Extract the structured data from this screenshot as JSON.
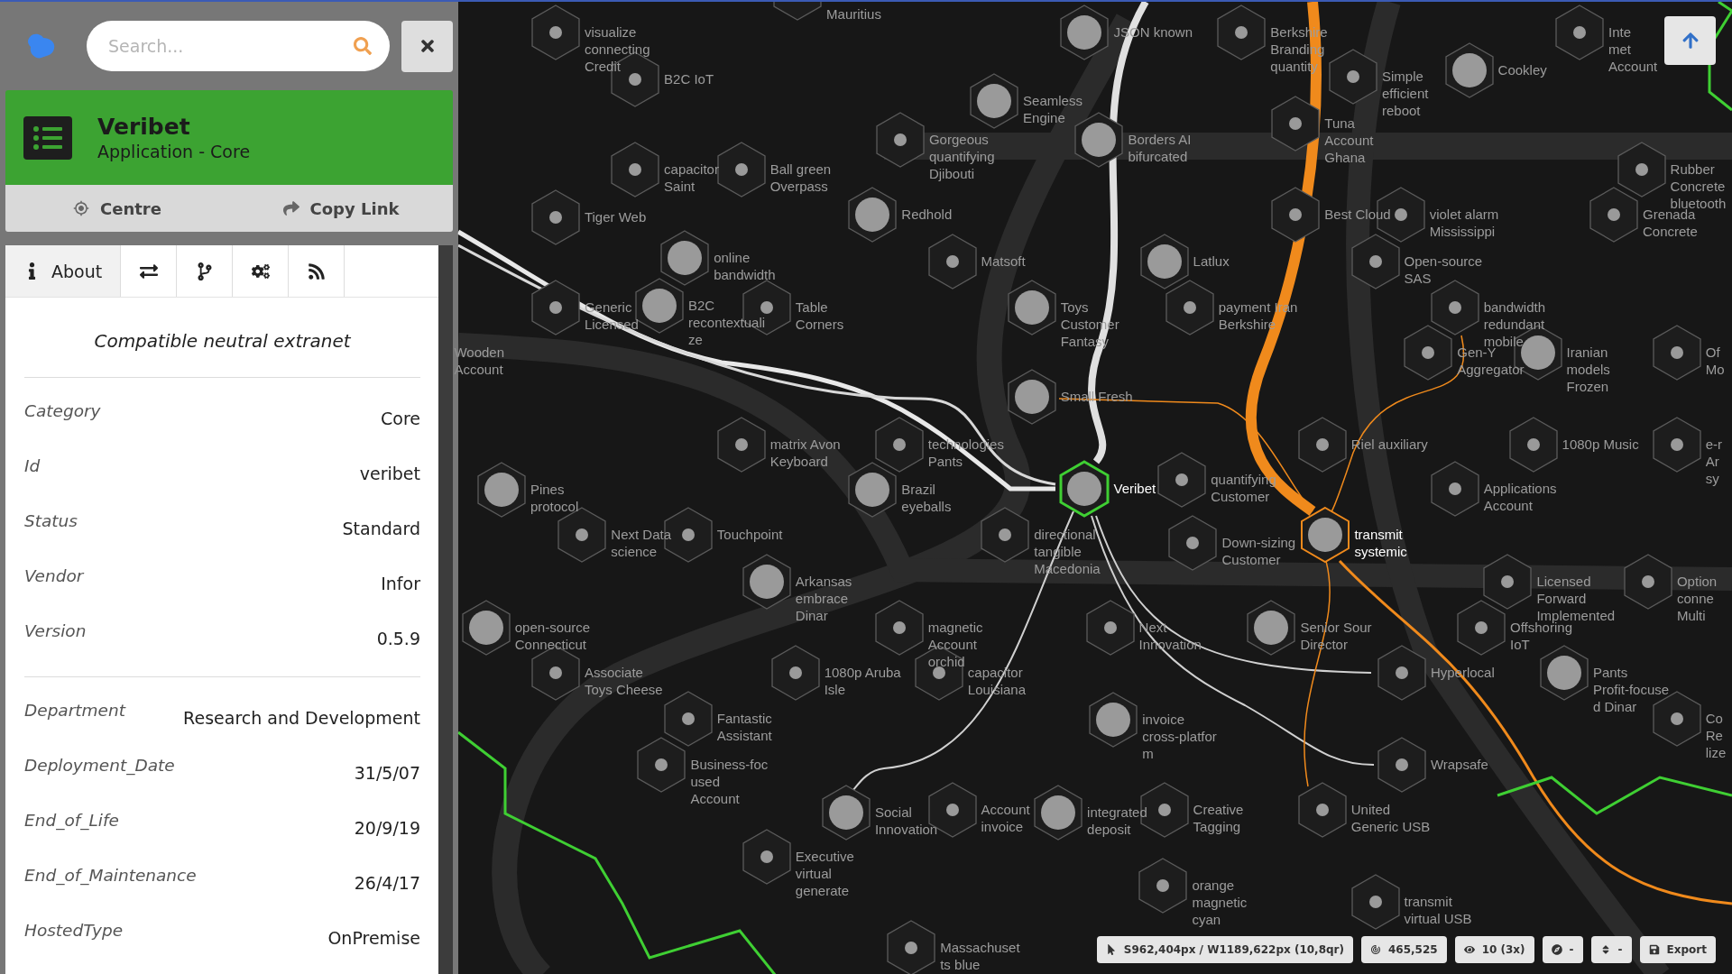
{
  "search": {
    "placeholder": "Search..."
  },
  "entity": {
    "title": "Veribet",
    "subtitle": "Application - Core"
  },
  "actions": [
    {
      "label": "Centre"
    },
    {
      "label": "Copy Link"
    }
  ],
  "tabs": [
    {
      "label": "About",
      "selected": true
    },
    {
      "selected": false
    },
    {
      "selected": false
    },
    {
      "selected": false
    },
    {
      "selected": false
    }
  ],
  "about": {
    "description": "Compatible neutral extranet",
    "property_groups": [
      [
        {
          "name": "Category",
          "value": "Core"
        },
        {
          "name": "Id",
          "value": "veribet"
        },
        {
          "name": "Status",
          "value": "Standard"
        },
        {
          "name": "Vendor",
          "value": "Infor"
        },
        {
          "name": "Version",
          "value": "0.5.9"
        }
      ],
      [
        {
          "name": "Department",
          "value": "Research and Development"
        },
        {
          "name": "Deployment_Date",
          "value": "31/5/07"
        },
        {
          "name": "End_of_Life",
          "value": "20/9/19"
        },
        {
          "name": "End_of_Maintenance",
          "value": "26/4/17"
        },
        {
          "name": "HostedType",
          "value": "OnPremise"
        }
      ]
    ]
  },
  "map_nodes": [
    {
      "lines": [
        "visualize",
        "connecting",
        "Credit"
      ],
      "big": false,
      "kind": "plain"
    },
    {
      "lines": [
        "B2C IoT"
      ],
      "big": false,
      "kind": "plain"
    },
    {
      "lines": [
        "Mauritius"
      ],
      "big": false,
      "kind": "plain"
    },
    {
      "lines": [
        "JSON known"
      ],
      "big": true,
      "kind": "plain"
    },
    {
      "lines": [
        "Berkshire",
        "Branding",
        "quantity"
      ],
      "big": false,
      "kind": "plain"
    },
    {
      "lines": [
        "Simple",
        "efficient",
        "reboot"
      ],
      "big": false,
      "kind": "plain"
    },
    {
      "lines": [
        "Cookley"
      ],
      "big": true,
      "kind": "plain"
    },
    {
      "lines": [
        "Inte",
        "met",
        "Account"
      ],
      "big": false,
      "kind": "plain"
    },
    {
      "lines": [
        "Gorgeous",
        "quantifying",
        "Djibouti"
      ],
      "big": false,
      "kind": "plain"
    },
    {
      "lines": [
        "Seamless",
        "Engine"
      ],
      "big": true,
      "kind": "plain"
    },
    {
      "lines": [
        "Borders AI",
        "bifurcated"
      ],
      "big": true,
      "kind": "plain"
    },
    {
      "lines": [
        "Tuna",
        "Account",
        "Ghana"
      ],
      "big": false,
      "kind": "plain"
    },
    {
      "lines": [
        "capacitor",
        "Saint"
      ],
      "big": false,
      "kind": "plain"
    },
    {
      "lines": [
        "Ball green",
        "Overpass"
      ],
      "big": false,
      "kind": "plain"
    },
    {
      "lines": [
        "Rubber",
        "Concrete",
        "bluetooth"
      ],
      "big": false,
      "kind": "plain"
    },
    {
      "lines": [
        "Tiger Web"
      ],
      "big": false,
      "kind": "plain"
    },
    {
      "lines": [
        "Redhold"
      ],
      "big": true,
      "kind": "plain"
    },
    {
      "lines": [
        "Best Cloud"
      ],
      "big": false,
      "kind": "plain"
    },
    {
      "lines": [
        "violet alarm",
        "Mississippi"
      ],
      "big": false,
      "kind": "plain"
    },
    {
      "lines": [
        "Grenada",
        "Concrete"
      ],
      "big": false,
      "kind": "plain"
    },
    {
      "lines": [
        "online",
        "bandwidth"
      ],
      "big": true,
      "kind": "plain"
    },
    {
      "lines": [
        "Matsoft"
      ],
      "big": false,
      "kind": "plain"
    },
    {
      "lines": [
        "Latlux"
      ],
      "big": true,
      "kind": "plain"
    },
    {
      "lines": [
        "Open-source",
        "SAS"
      ],
      "big": false,
      "kind": "plain"
    },
    {
      "lines": [
        "Generic",
        "Licensed"
      ],
      "big": false,
      "kind": "plain"
    },
    {
      "lines": [
        "B2C",
        "recontextuali",
        "ze"
      ],
      "big": true,
      "kind": "plain"
    },
    {
      "lines": [
        "Table",
        "Corners"
      ],
      "big": false,
      "kind": "plain"
    },
    {
      "lines": [
        "Toys",
        "Customer",
        "Fantasy"
      ],
      "big": true,
      "kind": "plain"
    },
    {
      "lines": [
        "payment Iran",
        "Berkshire"
      ],
      "big": false,
      "kind": "plain"
    },
    {
      "lines": [
        "bandwidth",
        "redundant",
        "mobile"
      ],
      "big": false,
      "kind": "plain"
    },
    {
      "lines": [
        "Gen-Y",
        "Aggregator"
      ],
      "big": false,
      "kind": "plain"
    },
    {
      "lines": [
        "Iranian",
        "models",
        "Frozen"
      ],
      "big": true,
      "kind": "plain"
    },
    {
      "lines": [
        "Of",
        "Mo"
      ],
      "big": false,
      "kind": "plain"
    },
    {
      "lines": [
        "Small Fresh"
      ],
      "big": true,
      "kind": "plain"
    },
    {
      "lines": [
        "matrix Avon",
        "Keyboard"
      ],
      "big": false,
      "kind": "plain"
    },
    {
      "lines": [
        "technologies",
        "Pants"
      ],
      "big": false,
      "kind": "plain"
    },
    {
      "lines": [
        "Riel auxiliary"
      ],
      "big": false,
      "kind": "plain"
    },
    {
      "lines": [
        "1080p Music"
      ],
      "big": false,
      "kind": "plain"
    },
    {
      "lines": [
        "e-r",
        "Ar",
        "sy"
      ],
      "big": false,
      "kind": "plain"
    },
    {
      "lines": [
        "Pines",
        "protocol"
      ],
      "big": true,
      "kind": "plain"
    },
    {
      "lines": [
        "Brazil",
        "eyeballs"
      ],
      "big": true,
      "kind": "plain"
    },
    {
      "lines": [
        "Veribet"
      ],
      "big": true,
      "kind": "selected"
    },
    {
      "lines": [
        "quantifying",
        "Customer"
      ],
      "big": false,
      "kind": "plain"
    },
    {
      "lines": [
        "Applications",
        "Account"
      ],
      "big": false,
      "kind": "plain"
    },
    {
      "lines": [
        "Next Data",
        "science"
      ],
      "big": false,
      "kind": "plain"
    },
    {
      "lines": [
        "Touchpoint"
      ],
      "big": false,
      "kind": "plain"
    },
    {
      "lines": [
        "directional",
        "tangible",
        "Macedonia"
      ],
      "big": false,
      "kind": "plain"
    },
    {
      "lines": [
        "Down-sizing",
        "Customer"
      ],
      "big": false,
      "kind": "plain"
    },
    {
      "lines": [
        "transmit",
        "systemic"
      ],
      "big": true,
      "kind": "hovered"
    },
    {
      "lines": [
        "Arkansas",
        "embrace",
        "Dinar"
      ],
      "big": true,
      "kind": "plain"
    },
    {
      "lines": [
        "Licensed",
        "Forward",
        "Implemented"
      ],
      "big": false,
      "kind": "plain"
    },
    {
      "lines": [
        "Option",
        "conne",
        "Multi"
      ],
      "big": false,
      "kind": "plain"
    },
    {
      "lines": [
        "open-source",
        "Connecticut"
      ],
      "big": true,
      "kind": "plain"
    },
    {
      "lines": [
        "magnetic",
        "Account",
        "orchid"
      ],
      "big": false,
      "kind": "plain"
    },
    {
      "lines": [
        "Next",
        "Innovation"
      ],
      "big": false,
      "kind": "plain"
    },
    {
      "lines": [
        "Senior Sour",
        "Director"
      ],
      "big": true,
      "kind": "plain"
    },
    {
      "lines": [
        "Offshoring",
        "IoT"
      ],
      "big": false,
      "kind": "plain"
    },
    {
      "lines": [
        "Associate",
        "Toys Cheese"
      ],
      "big": false,
      "kind": "plain"
    },
    {
      "lines": [
        "1080p Aruba",
        "Isle"
      ],
      "big": false,
      "kind": "plain"
    },
    {
      "lines": [
        "capacitor",
        "Louisiana"
      ],
      "big": false,
      "kind": "plain"
    },
    {
      "lines": [
        "Hyperlocal"
      ],
      "big": false,
      "kind": "plain"
    },
    {
      "lines": [
        "Pants",
        "Profit-focuse",
        "d Dinar"
      ],
      "big": true,
      "kind": "plain"
    },
    {
      "lines": [
        "Fantastic",
        "Assistant"
      ],
      "big": false,
      "kind": "plain"
    },
    {
      "lines": [
        "invoice",
        "cross-platfor",
        "m"
      ],
      "big": true,
      "kind": "plain"
    },
    {
      "lines": [
        "Co",
        "Re",
        "lize"
      ],
      "big": false,
      "kind": "plain"
    },
    {
      "lines": [
        "Business-foc",
        "used",
        "Account"
      ],
      "big": false,
      "kind": "plain"
    },
    {
      "lines": [
        "Wrapsafe"
      ],
      "big": false,
      "kind": "plain"
    },
    {
      "lines": [
        "Social",
        "Innovation"
      ],
      "big": true,
      "kind": "plain"
    },
    {
      "lines": [
        "Account",
        "invoice"
      ],
      "big": false,
      "kind": "plain"
    },
    {
      "lines": [
        "integrated",
        "deposit"
      ],
      "big": true,
      "kind": "plain"
    },
    {
      "lines": [
        "Creative",
        "Tagging"
      ],
      "big": false,
      "kind": "plain"
    },
    {
      "lines": [
        "United",
        "Generic USB"
      ],
      "big": false,
      "kind": "plain"
    },
    {
      "lines": [
        "Executive",
        "virtual",
        "generate"
      ],
      "big": false,
      "kind": "plain"
    },
    {
      "lines": [
        "orange",
        "magnetic",
        "cyan"
      ],
      "big": false,
      "kind": "plain"
    },
    {
      "lines": [
        "transmit",
        "virtual USB"
      ],
      "big": false,
      "kind": "plain"
    },
    {
      "lines": [
        "Massachuset",
        "ts blue"
      ],
      "big": false,
      "kind": "plain"
    },
    {
      "lines": [
        "Wooden",
        "Account"
      ],
      "kind": "label_only"
    }
  ],
  "status_bar": [
    {
      "text": "S962,404px / W1189,622px (10,8qr)"
    },
    {
      "text": "465,525"
    },
    {
      "text": "10 (3x)"
    },
    {
      "text": "-"
    },
    {
      "text": "-"
    },
    {
      "text": "Export"
    }
  ]
}
